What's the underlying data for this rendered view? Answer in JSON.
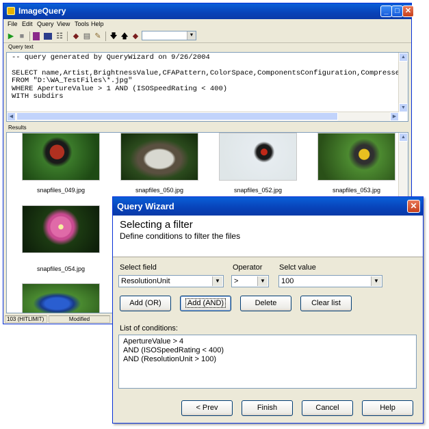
{
  "main": {
    "title": "ImageQuery",
    "menu": [
      "File",
      "Edit",
      "Query",
      "View",
      "Tools",
      "Help"
    ],
    "query_label": "Query text",
    "query_lines": [
      "-- query generated by QueryWizard on 9/26/2004",
      "",
      "SELECT name,Artist,BrightnessValue,CFAPattern,ColorSpace,ComponentsConfiguration,Compresse",
      "FROM \"D:\\WA_TestFiles\\*.jpg\"",
      "WHERE ApertureValue > 1 AND (ISOSpeedRating < 400)",
      "WITH subdirs"
    ],
    "results_label": "Results",
    "files": [
      "snapfiles_049.jpg",
      "snapfiles_050.jpg",
      "snapfiles_052.jpg",
      "snapfiles_053.jpg",
      "snapfiles_054.jpg"
    ],
    "status": [
      "103 (HITLIMIT)",
      "Modified"
    ]
  },
  "wizard": {
    "title": "Query Wizard",
    "heading": "Selecting a filter",
    "subheading": "Define conditions to filter the files",
    "field_label": "Select field",
    "field_value": "ResolutionUnit",
    "operator_label": "Operator",
    "operator_value": ">",
    "value_label": "Selct value",
    "value_value": "100",
    "add_or": "Add (OR)",
    "add_and": "Add (AND)",
    "delete": "Delete",
    "clear": "Clear list",
    "conditions_label": "List of conditions:",
    "conditions": [
      "ApertureValue > 4",
      "AND (ISOSpeedRating < 400)",
      "AND (ResolutionUnit > 100)"
    ],
    "prev": "< Prev",
    "finish": "Finish",
    "cancel": "Cancel",
    "help": "Help"
  }
}
